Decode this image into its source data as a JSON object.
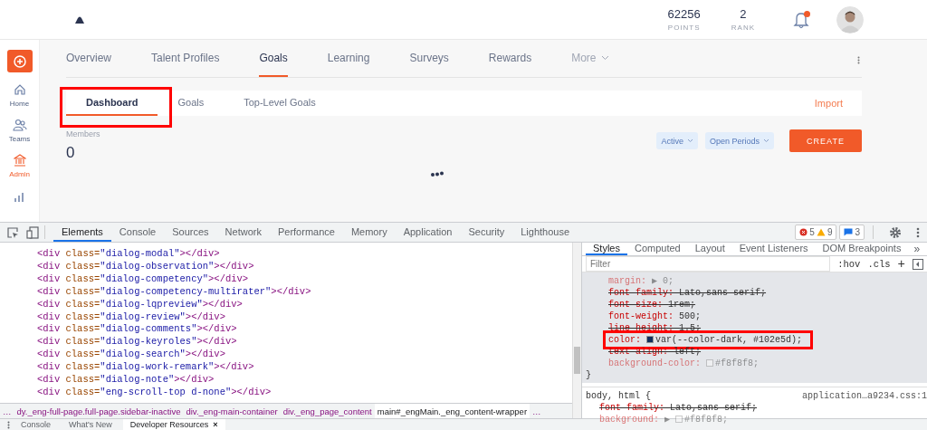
{
  "header": {
    "stats": [
      {
        "value": "62256",
        "label": "POINTS"
      },
      {
        "value": "2",
        "label": "RANK"
      }
    ],
    "notification": true
  },
  "sidebar": {
    "items": [
      {
        "label": "Home",
        "kind": "home",
        "selected": false
      },
      {
        "label": "Teams",
        "kind": "teams",
        "selected": false
      },
      {
        "label": "Admin",
        "kind": "admin",
        "selected": true
      }
    ]
  },
  "nav": {
    "tabs": [
      {
        "label": "Overview",
        "kind": "link",
        "selected": false
      },
      {
        "label": "Talent Profiles",
        "kind": "link",
        "selected": false
      },
      {
        "label": "Goals",
        "kind": "link",
        "selected": true
      },
      {
        "label": "Learning",
        "kind": "link",
        "selected": false
      },
      {
        "label": "Surveys",
        "kind": "link",
        "selected": false
      },
      {
        "label": "Rewards",
        "kind": "link",
        "selected": false
      },
      {
        "label": "More",
        "kind": "menu",
        "selected": false
      }
    ]
  },
  "subtabs": [
    {
      "label": "Dashboard",
      "selected": true,
      "highlighted": true
    },
    {
      "label": "Goals",
      "selected": false,
      "highlighted": false
    },
    {
      "label": "Top-Level Goals",
      "selected": false,
      "highlighted": false
    }
  ],
  "import": "Import",
  "members": {
    "label": "Members",
    "value": "0"
  },
  "filters": [
    "Active",
    "Open Periods"
  ],
  "create": "CREATE",
  "devtools": {
    "tabs": [
      {
        "label": "Elements",
        "selected": true
      },
      {
        "label": "Console",
        "selected": false
      },
      {
        "label": "Sources",
        "selected": false
      },
      {
        "label": "Network",
        "selected": false
      },
      {
        "label": "Performance",
        "selected": false
      },
      {
        "label": "Memory",
        "selected": false
      },
      {
        "label": "Application",
        "selected": false
      },
      {
        "label": "Security",
        "selected": false
      },
      {
        "label": "Lighthouse",
        "selected": false
      }
    ],
    "errors": "5",
    "warnings": "9",
    "messages": "3",
    "lines": [
      [
        {
          "t": "<div",
          "kind": "tag"
        },
        {
          "t": " class=",
          "kind": "attr"
        },
        {
          "t": "\"dialog-modal\"",
          "kind": "value"
        },
        {
          "t": "></div>",
          "kind": "tag"
        }
      ],
      [
        {
          "t": "<div",
          "kind": "tag"
        },
        {
          "t": " class=",
          "kind": "attr"
        },
        {
          "t": "\"dialog-observation\"",
          "kind": "value"
        },
        {
          "t": "></div>",
          "kind": "tag"
        }
      ],
      [
        {
          "t": "<div",
          "kind": "tag"
        },
        {
          "t": " class=",
          "kind": "attr"
        },
        {
          "t": "\"dialog-competency\"",
          "kind": "value"
        },
        {
          "t": "></div>",
          "kind": "tag"
        }
      ],
      [
        {
          "t": "<div",
          "kind": "tag"
        },
        {
          "t": " class=",
          "kind": "attr"
        },
        {
          "t": "\"dialog-competency-multirater\"",
          "kind": "value"
        },
        {
          "t": "></div>",
          "kind": "tag"
        }
      ],
      [
        {
          "t": "<div",
          "kind": "tag"
        },
        {
          "t": " class=",
          "kind": "attr"
        },
        {
          "t": "\"dialog-lqpreview\"",
          "kind": "value"
        },
        {
          "t": "></div>",
          "kind": "tag"
        }
      ],
      [
        {
          "t": "<div",
          "kind": "tag"
        },
        {
          "t": " class=",
          "kind": "attr"
        },
        {
          "t": "\"dialog-review\"",
          "kind": "value"
        },
        {
          "t": "></div>",
          "kind": "tag"
        }
      ],
      [
        {
          "t": "<div",
          "kind": "tag"
        },
        {
          "t": " class=",
          "kind": "attr"
        },
        {
          "t": "\"dialog-comments\"",
          "kind": "value"
        },
        {
          "t": "></div>",
          "kind": "tag"
        }
      ],
      [
        {
          "t": "<div",
          "kind": "tag"
        },
        {
          "t": " class=",
          "kind": "attr"
        },
        {
          "t": "\"dialog-keyroles\"",
          "kind": "value"
        },
        {
          "t": "></div>",
          "kind": "tag"
        }
      ],
      [
        {
          "t": "<div",
          "kind": "tag"
        },
        {
          "t": " class=",
          "kind": "attr"
        },
        {
          "t": "\"dialog-search\"",
          "kind": "value"
        },
        {
          "t": "></div>",
          "kind": "tag"
        }
      ],
      [
        {
          "t": "<div",
          "kind": "tag"
        },
        {
          "t": " class=",
          "kind": "attr"
        },
        {
          "t": "\"dialog-work-remark\"",
          "kind": "value"
        },
        {
          "t": "></div>",
          "kind": "tag"
        }
      ],
      [
        {
          "t": "<div",
          "kind": "tag"
        },
        {
          "t": " class=",
          "kind": "attr"
        },
        {
          "t": "\"dialog-note\"",
          "kind": "value"
        },
        {
          "t": "></div>",
          "kind": "tag"
        }
      ],
      [
        {
          "t": "<div",
          "kind": "tag"
        },
        {
          "t": " class=",
          "kind": "attr"
        },
        {
          "t": "\"eng-scroll-top d-none\"",
          "kind": "value"
        },
        {
          "t": "></div>",
          "kind": "tag"
        }
      ]
    ],
    "breadcrumb": [
      {
        "text": "…",
        "selected": false
      },
      {
        "text": "dy._eng-full-page.full-page.sidebar-inactive",
        "selected": false
      },
      {
        "text": "div._eng-main-container",
        "selected": false
      },
      {
        "text": "div._eng_page_content",
        "selected": false
      },
      {
        "text": "main#_engMain._eng_content-wrapper",
        "selected": true
      },
      {
        "text": "…",
        "selected": false
      }
    ],
    "styles": {
      "tabs": [
        {
          "label": "Styles",
          "selected": true
        },
        {
          "label": "Computed",
          "selected": false
        },
        {
          "label": "Layout",
          "selected": false
        },
        {
          "label": "Event Listeners",
          "selected": false
        },
        {
          "label": "DOM Breakpoints",
          "selected": false
        }
      ],
      "more": "»",
      "filter": {
        "placeholder": "Filter"
      },
      "hov": ":hov",
      "cls": ".cls",
      "add": "+",
      "rules": [
        {
          "declarations": [
            {
              "property": "margin:",
              "prefix": "▶",
              "value": "0;",
              "kind": "inactive",
              "highlighted": false
            },
            {
              "property": "font-family:",
              "value": "Lato,sans-serif;",
              "kind": "overridden",
              "highlighted": false
            },
            {
              "property": "font-size:",
              "value": "1rem;",
              "kind": "overridden",
              "highlighted": false
            },
            {
              "property": "font-weight:",
              "value": "500;",
              "kind": "active",
              "highlighted": false
            },
            {
              "property": "line-height:",
              "value": "1.5;",
              "kind": "overridden",
              "highlighted": false
            },
            {
              "property": "color:",
              "color": "#102e5d",
              "value": "var(--color-dark, #102e5d);",
              "kind": "active",
              "highlighted": true
            },
            {
              "property": "text-align:",
              "value": "left;",
              "kind": "overridden",
              "highlighted": false
            },
            {
              "property": "background-color:",
              "color": "#f8f8f8",
              "value": "#f8f8f8;",
              "kind": "inactive",
              "highlighted": false
            }
          ],
          "close": "}"
        },
        {
          "selector": "body, html {",
          "source": "application…a9234.css:1",
          "declarations": [
            {
              "property": "font-family:",
              "value": "Lato,sans-serif;",
              "kind": "overridden",
              "highlighted": false
            },
            {
              "property": "background:",
              "prefix": "▶",
              "color": "#f8f8f8",
              "value": "#f8f8f8;",
              "kind": "inactive",
              "highlighted": false
            }
          ]
        }
      ]
    },
    "drawer": {
      "tabs": [
        {
          "label": "Console",
          "selected": false
        },
        {
          "label": "What's New",
          "selected": false
        },
        {
          "label": "Developer Resources",
          "selected": true,
          "close": "×"
        }
      ]
    }
  }
}
